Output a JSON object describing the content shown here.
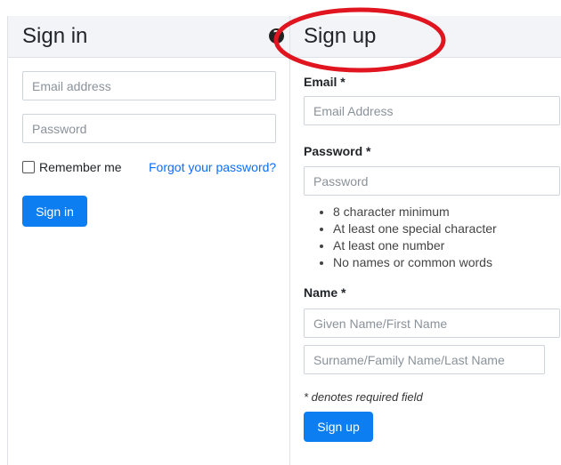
{
  "signin": {
    "title": "Sign in",
    "email_placeholder": "Email address",
    "password_placeholder": "Password",
    "remember_label": "Remember me",
    "forgot_link": "Forgot your password?",
    "button_label": "Sign in",
    "help_icon_glyph": "?"
  },
  "signup": {
    "title": "Sign up",
    "email_label": "Email *",
    "email_placeholder": "Email Address",
    "password_label": "Password *",
    "password_placeholder": "Password",
    "password_rules": [
      "8 character minimum",
      "At least one special character",
      "At least one number",
      "No names or common words"
    ],
    "name_label": "Name *",
    "given_name_placeholder": "Given Name/First Name",
    "surname_placeholder": "Surname/Family Name/Last Name",
    "required_note": "* denotes required field",
    "button_label": "Sign up"
  },
  "colors": {
    "primary": "#0d7ef1",
    "link": "#0d6efd",
    "header_bg": "#f3f4f7",
    "annotation": "#e0151f"
  },
  "icons": {
    "help": "question-circle-icon"
  }
}
